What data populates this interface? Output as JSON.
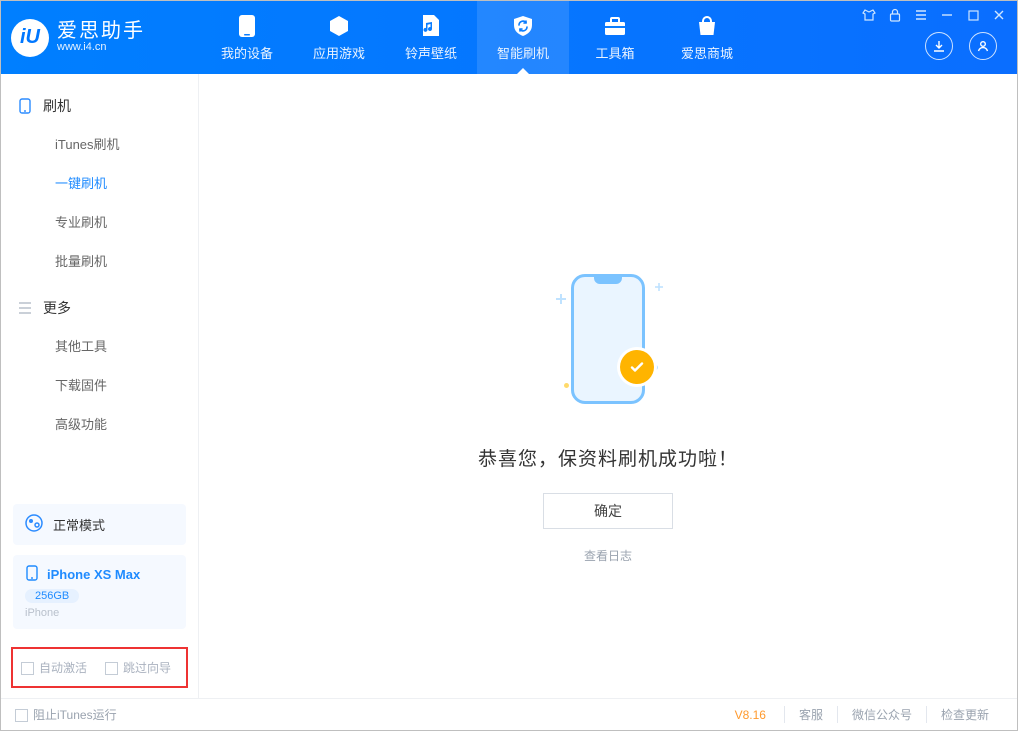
{
  "app": {
    "title": "爱思助手",
    "url": "www.i4.cn",
    "logo_letter": "iU"
  },
  "nav": {
    "device": "我的设备",
    "apps": "应用游戏",
    "ringtones": "铃声壁纸",
    "flash": "智能刷机",
    "toolbox": "工具箱",
    "store": "爱思商城"
  },
  "sidebar": {
    "flash_header": "刷机",
    "items": {
      "itunes": "iTunes刷机",
      "oneclick": "一键刷机",
      "pro": "专业刷机",
      "batch": "批量刷机"
    },
    "more_header": "更多",
    "more": {
      "other": "其他工具",
      "firmware": "下载固件",
      "advanced": "高级功能"
    },
    "mode_label": "正常模式",
    "phone": {
      "name": "iPhone XS Max",
      "storage": "256GB",
      "type": "iPhone"
    },
    "opts": {
      "auto_activate": "自动激活",
      "skip_guide": "跳过向导"
    }
  },
  "main": {
    "success": "恭喜您，保资料刷机成功啦！",
    "ok": "确定",
    "view_log": "查看日志"
  },
  "footer": {
    "block_itunes": "阻止iTunes运行",
    "version": "V8.16",
    "support": "客服",
    "wechat": "微信公众号",
    "update": "检查更新"
  }
}
